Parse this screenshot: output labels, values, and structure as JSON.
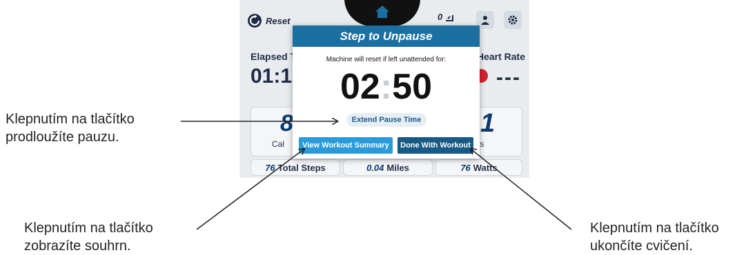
{
  "annotations": {
    "extend": [
      "Klepnutím na tlačítko",
      "prodloužíte pauzu."
    ],
    "summary": [
      "Klepnutím na tlačítko",
      "zobrazíte souhrn."
    ],
    "done": [
      "Klepnutím na tlačítko",
      "ukončíte cvičení."
    ]
  },
  "screen": {
    "topbar": {
      "reset_label": "Reset",
      "steps_count": "0"
    },
    "elapsed": {
      "label": "Elapsed Ti",
      "value": "01:1"
    },
    "heart_rate": {
      "label": "Heart Rate",
      "value": "---"
    },
    "card_left": {
      "value": "8",
      "label": "Cal"
    },
    "card_right": {
      "value": "1",
      "label": "ts"
    },
    "stats": {
      "steps": {
        "value": "76",
        "label": "Total Steps"
      },
      "miles": {
        "value": "0.04",
        "label": "Miles"
      },
      "watts": {
        "value": "76",
        "label": "Watts"
      }
    }
  },
  "modal": {
    "title": "Step to Unpause",
    "subtitle": "Machine will reset if left unattended for:",
    "countdown": {
      "minutes": "02",
      "separator": ":",
      "seconds": "50"
    },
    "extend_label": "Extend Pause Time",
    "summary_label": "View Workout Summary",
    "done_label": "Done With Workout"
  },
  "colors": {
    "header_blue": "#1c6fa1",
    "summary_button": "#2a9bd8",
    "done_button": "#175a85",
    "heart_red": "#d6212e"
  },
  "icons": [
    "reset-icon",
    "home-icon",
    "steps-icon",
    "user-icon",
    "gear-icon",
    "heart-icon"
  ]
}
